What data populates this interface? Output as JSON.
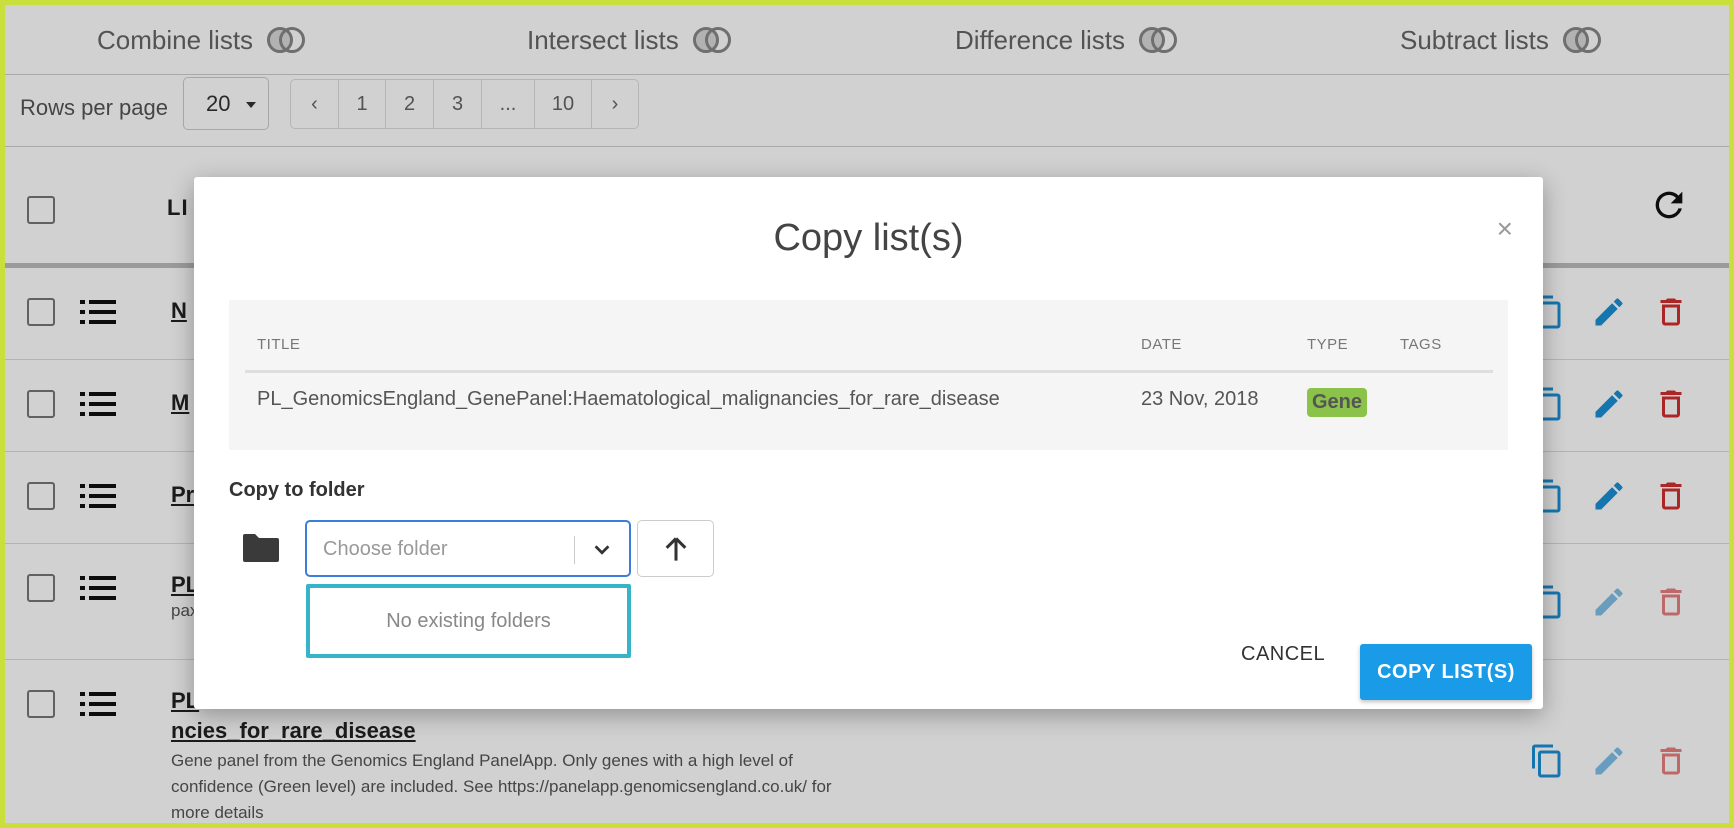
{
  "setops": [
    {
      "label": "Combine lists"
    },
    {
      "label": "Intersect lists"
    },
    {
      "label": "Difference lists"
    },
    {
      "label": "Subtract lists"
    }
  ],
  "pager": {
    "rows_per_page_label": "Rows per page",
    "rows_per_page_value": "20",
    "prev": "‹",
    "pages": [
      "1",
      "2",
      "3",
      "...",
      "10"
    ],
    "next": "›"
  },
  "table": {
    "title_header": "LI",
    "rows": [
      {
        "title": "N"
      },
      {
        "title": "M"
      },
      {
        "title": "Pr"
      },
      {
        "title": "PL",
        "desc": "pax"
      },
      {
        "title": "PL",
        "title2": "ncies_for_rare_disease",
        "desc": "Gene panel from the Genomics England PanelApp. Only genes with a high level of confidence (Green level) are included. See https://panelapp.genomicsengland.co.uk/ for more details"
      }
    ]
  },
  "modal": {
    "title": "Copy list(s)",
    "close": "×",
    "columns": {
      "title": "TITLE",
      "date": "DATE",
      "type": "TYPE",
      "tags": "TAGS"
    },
    "item": {
      "title": "PL_GenomicsEngland_GenePanel:Haematological_malignancies_for_rare_disease",
      "date": "23 Nov, 2018",
      "type": "Gene"
    },
    "copy_to_label": "Copy to folder",
    "folder_placeholder": "Choose folder",
    "no_folders": "No existing folders",
    "cancel": "CANCEL",
    "confirm": "COPY LIST(S)"
  },
  "colors": {
    "frame": "#c9e03c",
    "primary": "#1a9be8",
    "gene_badge": "#8bc34a",
    "edit": "#1a8fd6",
    "delete": "#d32f2f",
    "dropdown_border": "#36b5c8"
  }
}
